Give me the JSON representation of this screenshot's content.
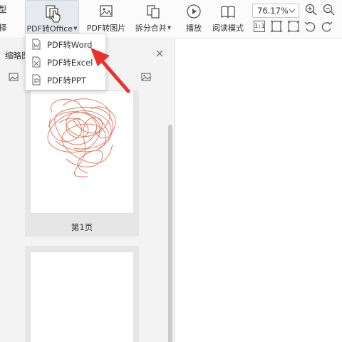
{
  "ribbon": {
    "left_labels": [
      "型",
      "择"
    ],
    "buttons": [
      {
        "label": "PDF转Office",
        "icon": "pdf-convert-icon",
        "has_caret": true
      },
      {
        "label": "PDF转图片",
        "icon": "pdf-to-image-icon"
      },
      {
        "label": "拆分合并",
        "icon": "split-merge-icon",
        "has_caret": true
      },
      {
        "label": "播放",
        "icon": "play-icon"
      },
      {
        "label": "阅读模式",
        "icon": "read-mode-icon"
      }
    ],
    "zoom": {
      "value": "76.17%"
    },
    "actual_size_label": "1:1"
  },
  "panel": {
    "title": "缩略图",
    "thumbnails": [
      {
        "label": "第1页"
      },
      {
        "label": ""
      }
    ]
  },
  "menu": {
    "items": [
      {
        "label": "PDF转Word"
      },
      {
        "label": "PDF转Excel"
      },
      {
        "label": "PDF转PPT"
      }
    ]
  },
  "colors": {
    "accent_red": "#e8322d",
    "scribble": "#d85a3e"
  }
}
